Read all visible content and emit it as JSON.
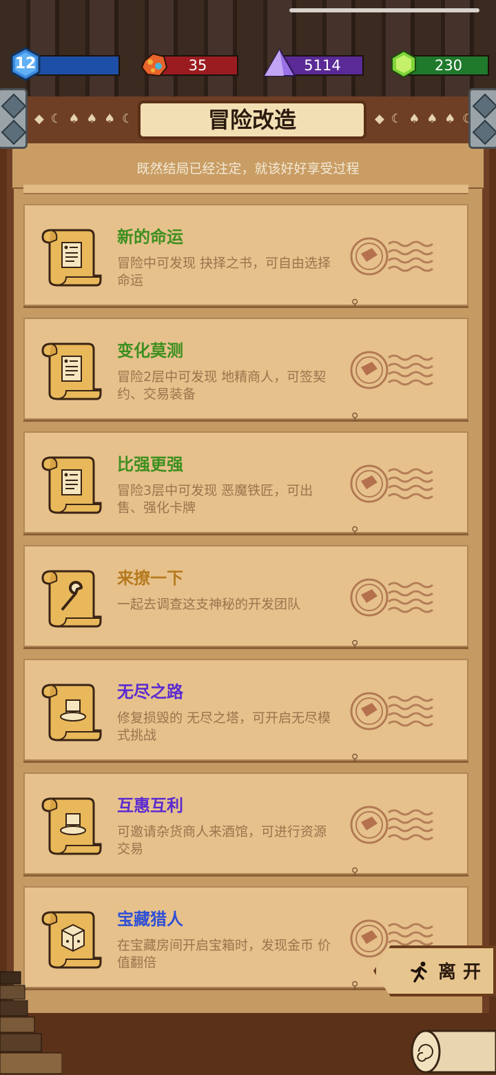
{
  "resources": {
    "level": "12",
    "ore": "35",
    "crystal": "5114",
    "gem": "230"
  },
  "header": {
    "title": "冒险改造",
    "subtitle": "既然结局已经注定，就该好好享受过程"
  },
  "cards": [
    {
      "title": "新的命运",
      "desc": "冒险中可发现 抉择之书，可自由选择命运",
      "title_color": "#3e8f1f",
      "icon": "scroll-document-icon"
    },
    {
      "title": "变化莫测",
      "desc": "冒险2层中可发现 地精商人，可签契约、交易装备",
      "title_color": "#3e8f1f",
      "icon": "scroll-document-icon"
    },
    {
      "title": "比强更强",
      "desc": "冒险3层中可发现 恶魔铁匠，可出售、强化卡牌",
      "title_color": "#3e8f1f",
      "icon": "scroll-document-icon"
    },
    {
      "title": "来撩一下",
      "desc": "一起去调查这支神秘的开发团队",
      "title_color": "#b67a1e",
      "icon": "scroll-wrench-icon"
    },
    {
      "title": "无尽之路",
      "desc": "修复损毁的 无尽之塔，可开启无尽模式挑战",
      "title_color": "#5a2ad0",
      "icon": "scroll-hat-icon"
    },
    {
      "title": "互惠互利",
      "desc": "可邀请杂货商人来酒馆，可进行资源交易",
      "title_color": "#5a2ad0",
      "icon": "scroll-hat-icon"
    },
    {
      "title": "宝藏猎人",
      "desc": "在宝藏房间开启宝箱时，发现金币 价值翻倍",
      "title_color": "#2d4fd6",
      "icon": "scroll-dice-icon"
    }
  ],
  "leave_button": {
    "label": "离开"
  },
  "colors": {
    "panel": "#6e3f24",
    "card": "#e6c18c",
    "level_bar": "#1e4fa6",
    "ore_bar": "#9b1c20",
    "crystal_bar": "#5a2a96",
    "gem_bar": "#1f7a2c"
  }
}
